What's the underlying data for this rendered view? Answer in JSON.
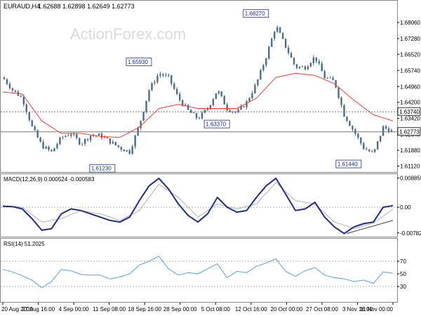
{
  "header": {
    "symbol": "EURAUD,H4",
    "ohlc": "1.62688 1.62898 1.62649 1.62773",
    "watermark": "ActionForex.com"
  },
  "colors": {
    "candle": "#4a6e8a",
    "ma": "#ff3b30",
    "macd": "#1f2d8c",
    "signal": "#b3b3b3",
    "rsi": "#5ba3d8",
    "tag_border": "#1f2d8c",
    "tag_text": "#1f2d8c",
    "grid": "#b0b0b0"
  },
  "chart_data": [
    {
      "type": "candlestick",
      "panel": "price",
      "title": "EURAUD,H4",
      "ylim": [
        1.61,
        1.686
      ],
      "y_ticks": [
        "1.68060",
        "1.67280",
        "1.66520",
        "1.65740",
        "1.64960",
        "1.64200",
        "1.63420",
        "1.62640",
        "1.61880",
        "1.61120"
      ],
      "x_ticks": [
        "20 Aug 2020",
        "27 Aug 16:00",
        "4 Sep 00:00",
        "11 Sep 08:00",
        "18 Sep 16:00",
        "28 Sep 00:00",
        "5 Oct 08:00",
        "12 Oct 16:00",
        "20 Oct 00:00",
        "27 Oct 08:00",
        "3 Nov 16:00",
        "11 Nov 00:00"
      ],
      "x_range": [
        0,
        160
      ],
      "series": [
        {
          "kind": "close",
          "x": [
            0,
            4,
            8,
            12,
            16,
            20,
            24,
            28,
            32,
            36,
            40,
            44,
            48,
            52,
            56,
            60,
            64,
            68,
            72,
            76,
            80,
            84,
            88,
            92,
            96,
            100,
            104,
            108,
            112,
            116,
            120,
            124,
            128,
            132,
            136,
            140,
            144,
            148,
            152,
            156,
            160
          ],
          "y": [
            1.654,
            1.648,
            1.644,
            1.63,
            1.621,
            1.618,
            1.625,
            1.627,
            1.622,
            1.626,
            1.626,
            1.623,
            1.62,
            1.618,
            1.631,
            1.648,
            1.656,
            1.654,
            1.644,
            1.638,
            1.634,
            1.639,
            1.648,
            1.639,
            1.637,
            1.642,
            1.651,
            1.664,
            1.679,
            1.669,
            1.659,
            1.659,
            1.664,
            1.654,
            1.652,
            1.636,
            1.628,
            1.62,
            1.617,
            1.63,
            1.6277
          ]
        },
        {
          "kind": "moving_average",
          "x": [
            0,
            8,
            16,
            24,
            32,
            40,
            48,
            56,
            64,
            72,
            80,
            88,
            96,
            104,
            112,
            120,
            128,
            136,
            144,
            152,
            160
          ],
          "y": [
            1.647,
            1.646,
            1.633,
            1.627,
            1.627,
            1.6255,
            1.625,
            1.63,
            1.639,
            1.641,
            1.639,
            1.639,
            1.639,
            1.644,
            1.654,
            1.656,
            1.655,
            1.651,
            1.643,
            1.636,
            1.633
          ]
        }
      ],
      "horizontal_lines": [
        {
          "value": 1.6374,
          "label": "1.63740",
          "style": "dotted"
        },
        {
          "value": 1.62773,
          "label": "1.62773",
          "style": "solid"
        }
      ],
      "annotations": [
        {
          "label": "1.65930",
          "x": 61,
          "y": 1.6593,
          "position": "above"
        },
        {
          "label": "1.61230",
          "x": 46,
          "y": 1.6123,
          "position": "below"
        },
        {
          "label": "1.68270",
          "x": 109,
          "y": 1.6827,
          "position": "above"
        },
        {
          "label": "1.63370",
          "x": 93,
          "y": 1.6337,
          "position": "below"
        },
        {
          "label": "1.61440",
          "x": 147,
          "y": 1.6144,
          "position": "below"
        }
      ]
    },
    {
      "type": "line",
      "panel": "macd",
      "title": "MACD(12,26,9) 0.000524 -0.000583",
      "ylim": [
        -0.0083,
        0.0092
      ],
      "y_ticks": [
        "0.008859",
        "0.00",
        "-0.007826"
      ],
      "series": [
        {
          "kind": "macd",
          "x": [
            0,
            4,
            8,
            12,
            16,
            20,
            24,
            28,
            32,
            36,
            40,
            44,
            48,
            52,
            56,
            60,
            64,
            68,
            72,
            76,
            80,
            84,
            88,
            92,
            96,
            100,
            104,
            108,
            112,
            116,
            120,
            124,
            128,
            132,
            136,
            140,
            144,
            148,
            152,
            156,
            160
          ],
          "y": [
            0.0003,
            0.0002,
            -0.0005,
            -0.0035,
            -0.007,
            -0.0065,
            -0.002,
            -0.0005,
            -0.001,
            -0.002,
            -0.003,
            -0.004,
            -0.0045,
            -0.003,
            0.002,
            0.0065,
            0.0088,
            0.0055,
            0.001,
            -0.0025,
            -0.0045,
            -0.002,
            0.003,
            0.0,
            -0.0015,
            -0.001,
            0.003,
            0.0065,
            0.0088,
            0.004,
            -0.001,
            -0.0005,
            0.0015,
            -0.003,
            -0.006,
            -0.008,
            -0.006,
            -0.005,
            -0.0045,
            0.0,
            0.0005
          ]
        },
        {
          "kind": "signal",
          "x": [
            0,
            8,
            16,
            24,
            32,
            40,
            48,
            56,
            64,
            72,
            80,
            88,
            96,
            104,
            112,
            120,
            128,
            136,
            144,
            152,
            160
          ],
          "y": [
            0.0005,
            0.0,
            -0.0045,
            -0.0035,
            -0.001,
            -0.002,
            -0.004,
            -0.001,
            0.007,
            0.003,
            -0.003,
            0.001,
            -0.0005,
            0.001,
            0.0075,
            0.002,
            0.001,
            -0.0045,
            -0.0065,
            -0.0048,
            -0.0006
          ]
        }
      ],
      "trend_line": {
        "x": [
          141,
          160
        ],
        "y": [
          -0.008,
          -0.004
        ]
      }
    },
    {
      "type": "line",
      "panel": "rsi",
      "title": "RSI(14) 51.2025",
      "ylim": [
        10,
        90
      ],
      "y_ticks": [
        "70",
        "50",
        "30"
      ],
      "levels": [
        70,
        30
      ],
      "series": [
        {
          "kind": "rsi",
          "x": [
            0,
            4,
            8,
            12,
            16,
            20,
            24,
            28,
            32,
            36,
            40,
            44,
            48,
            52,
            56,
            60,
            64,
            68,
            72,
            76,
            80,
            84,
            88,
            92,
            96,
            100,
            104,
            108,
            112,
            116,
            120,
            124,
            128,
            132,
            136,
            140,
            144,
            148,
            152,
            156,
            160
          ],
          "y": [
            57,
            53,
            47,
            40,
            28,
            38,
            57,
            55,
            49,
            48,
            48,
            42,
            45,
            50,
            64,
            70,
            78,
            58,
            48,
            52,
            50,
            58,
            66,
            44,
            54,
            52,
            62,
            67,
            74,
            54,
            46,
            55,
            60,
            48,
            44,
            42,
            38,
            40,
            35,
            53,
            51
          ]
        }
      ]
    }
  ]
}
